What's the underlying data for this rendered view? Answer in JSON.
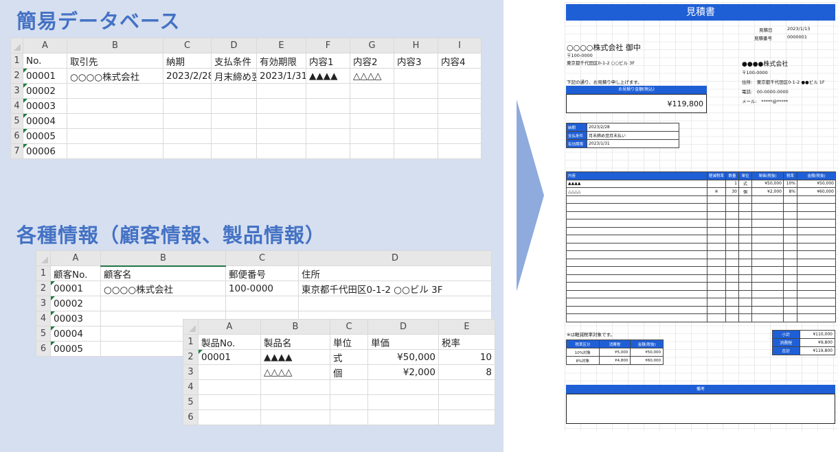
{
  "headings": {
    "database": "簡易データベース",
    "info": "各種情報（顧客情報、製品情報）"
  },
  "db_sheet": {
    "col_letters": [
      "A",
      "B",
      "C",
      "D",
      "E",
      "F",
      "G",
      "H",
      "I"
    ],
    "header_row": [
      "No.",
      "取引先",
      "納期",
      "支払条件",
      "有効期限",
      "内容1",
      "内容2",
      "内容3",
      "内容4"
    ],
    "rows": [
      [
        "00001",
        "○○○○株式会社",
        "2023/2/28",
        "月末締め翌",
        "2023/1/31",
        "▲▲▲▲",
        "△△△△",
        "",
        ""
      ],
      [
        "00002",
        "",
        "",
        "",
        "",
        "",
        "",
        "",
        ""
      ],
      [
        "00003",
        "",
        "",
        "",
        "",
        "",
        "",
        "",
        ""
      ],
      [
        "00004",
        "",
        "",
        "",
        "",
        "",
        "",
        "",
        ""
      ],
      [
        "00005",
        "",
        "",
        "",
        "",
        "",
        "",
        "",
        ""
      ],
      [
        "00006",
        "",
        "",
        "",
        "",
        "",
        "",
        "",
        ""
      ]
    ],
    "row_numbers": [
      "1",
      "2",
      "3",
      "4",
      "5",
      "6",
      "7"
    ]
  },
  "customer_sheet": {
    "col_letters": [
      "A",
      "B",
      "C",
      "D"
    ],
    "header_row": [
      "顧客No.",
      "顧客名",
      "郵便番号",
      "住所"
    ],
    "rows": [
      [
        "00001",
        "○○○○株式会社",
        "100-0000",
        "東京都千代田区0-1-2 ○○ビル 3F"
      ],
      [
        "00002",
        "",
        "",
        ""
      ],
      [
        "00003",
        "",
        "",
        ""
      ],
      [
        "00004",
        "",
        "",
        ""
      ],
      [
        "00005",
        "",
        "",
        ""
      ]
    ],
    "row_numbers": [
      "1",
      "2",
      "3",
      "4",
      "5",
      "6"
    ]
  },
  "product_sheet": {
    "col_letters": [
      "A",
      "B",
      "C",
      "D",
      "E"
    ],
    "header_row": [
      "製品No.",
      "製品名",
      "単位",
      "単価",
      "税率"
    ],
    "rows": [
      [
        "00001",
        "▲▲▲▲",
        "式",
        "¥50,000",
        "10"
      ],
      [
        "",
        "△△△△",
        "個",
        "¥2,000",
        "8"
      ],
      [
        "",
        "",
        "",
        "",
        ""
      ],
      [
        "",
        "",
        "",
        "",
        ""
      ],
      [
        "",
        "",
        "",
        "",
        ""
      ]
    ],
    "row_numbers": [
      "1",
      "2",
      "3",
      "4",
      "5",
      "6"
    ]
  },
  "estimate": {
    "title": "見積書",
    "date_label": "見積日",
    "date_value": "2023/1/13",
    "number_label": "見積番号",
    "number_value": "0000001",
    "recipient": "○○○○株式会社 御中",
    "recipient_postal": "〒100-0000",
    "recipient_address": "東京都千代田区0-1-2 ○○ビル 3F",
    "intro": "下記の通り、お見積り申し上げます。",
    "amount_label": "お見積り金額(税込)",
    "amount_value": "¥119,800",
    "issuer_name": "●●●●株式会社",
    "issuer_postal": "〒100-0000",
    "issuer_address": "住所:　東京都千代田区0-1-2 ●●ビル 1F",
    "issuer_phone": "電話:　00-0000-0000",
    "issuer_mail": "メール:　*****@*****",
    "terms": [
      {
        "k": "納期",
        "v": "2023/2/28"
      },
      {
        "k": "支払条件",
        "v": "月末締め翌月末払い"
      },
      {
        "k": "有効期限",
        "v": "2023/1/31"
      }
    ],
    "item_headers": [
      "内容",
      "軽減税率",
      "数量",
      "単位",
      "単価(税抜)",
      "税率",
      "金額(税抜)"
    ],
    "items": [
      [
        "▲▲▲▲",
        "",
        "1",
        "式",
        "¥50,000",
        "10%",
        "¥50,000"
      ],
      [
        "△△△△",
        "※",
        "30",
        "個",
        "¥2,000",
        "8%",
        "¥60,000"
      ]
    ],
    "reduced_note": "※は軽減税率対象です。",
    "tax_headers": [
      "税率区分",
      "消費税",
      "金額(税抜)"
    ],
    "tax_rows": [
      [
        "10%対象",
        "¥5,000",
        "¥50,000"
      ],
      [
        "8%対象",
        "¥4,800",
        "¥60,000"
      ]
    ],
    "totals": [
      {
        "k": "小計",
        "v": "¥110,000"
      },
      {
        "k": "消費税",
        "v": "¥9,800"
      },
      {
        "k": "合計",
        "v": "¥119,800"
      }
    ],
    "remarks_label": "備考"
  },
  "colors": {
    "panel_bg": "#d6dff0",
    "heading": "#4472c4",
    "arrow": "#8faadc",
    "doc_accent": "#1f5fd6",
    "green_marker": "#1e7d3c"
  }
}
